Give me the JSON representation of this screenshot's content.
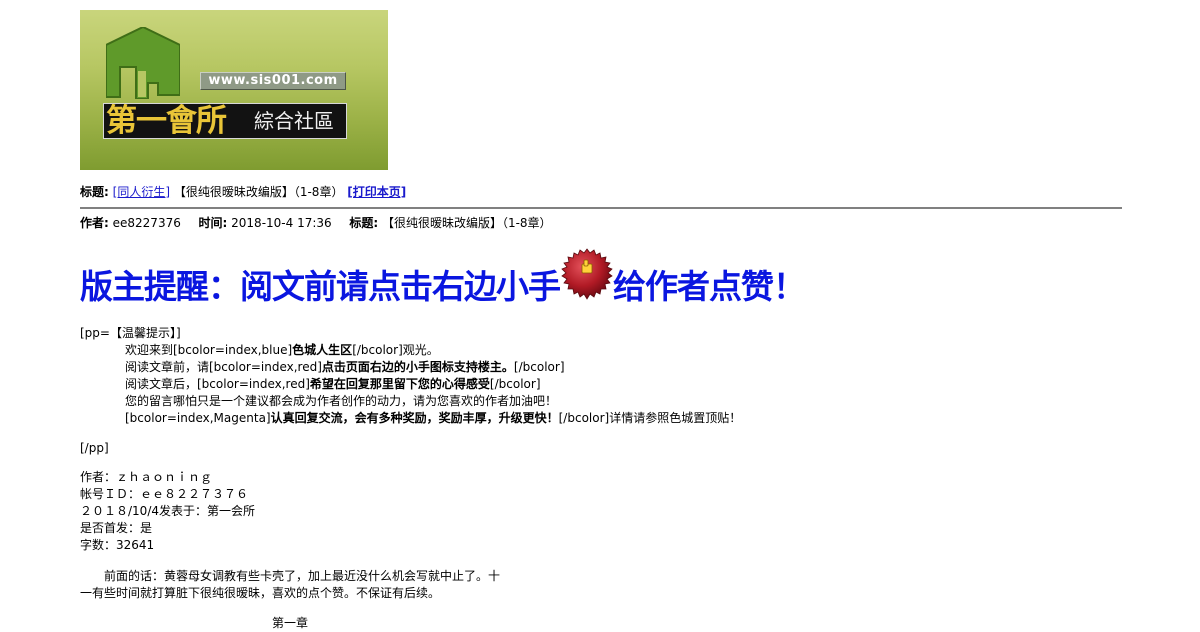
{
  "logo": {
    "url_text": "www.sis001.com",
    "name_big": "第一會所",
    "name_small": "綜合社區",
    "colors": {
      "green_top": "#c9d57c",
      "green_bottom": "#7f9c30",
      "house": "#5f9a2a",
      "gold": "#e9c538"
    }
  },
  "title_bar": {
    "label": "标题:",
    "category_link": "[同人衍生]",
    "title_text": "【很纯很暧昧改编版】（1-8章）",
    "print_link": "[打印本页]"
  },
  "meta": {
    "author_label": "作者:",
    "author_value": "ee8227376",
    "time_label": "时间:",
    "time_value": "2018-10-4 17:36",
    "title_label": "标题:",
    "title_value": "【很纯很暧昧改编版】（1-8章）"
  },
  "banner": {
    "text_before": "版主提醒：阅文前请点击右边小手",
    "text_after": "给作者点赞！",
    "color": "#0a16e0",
    "badge_icon": "thumbs-up-badge-icon"
  },
  "notice": {
    "open": "[pp=【温馨提示】]",
    "lines": [
      {
        "a": "欢迎来到[bcolor=index,blue]",
        "b": "色城人生区",
        "c": "[/bcolor]观光。"
      },
      {
        "a": "阅读文章前，请[bcolor=index,red]",
        "b": "点击页面右边的小手图标支持楼主。",
        "c": "[/bcolor]"
      },
      {
        "a": "阅读文章后，[bcolor=index,red]",
        "b": "希望在回复那里留下您的心得感受",
        "c": "[/bcolor]"
      },
      {
        "a": "您的留言哪怕只是一个建议都会成为作者创作的动力，请为您喜欢的作者加油吧！",
        "b": "",
        "c": ""
      },
      {
        "a": "[bcolor=index,Magenta]",
        "b": "认真回复交流，会有多种奖励，奖励丰厚，升级更快！",
        "c": "[/bcolor]详情请参照色城置顶贴！"
      }
    ],
    "close": "[/pp]"
  },
  "info": [
    "作者：ｚｈａｏｎｉｎｇ",
    "帐号ＩＤ：ｅｅ８２２７３７６",
    "２０１８/10/4发表于：第一会所",
    "是否首发：是",
    "字数：32641"
  ],
  "preface": {
    "line1": "　　前面的话：黄蓉母女调教有些卡壳了，加上最近没什么机会写就中止了。十",
    "line2": "一有些时间就打算脏下很纯很暧昧，喜欢的点个赞。不保证有后续。"
  },
  "chapter_heading": "第一章"
}
